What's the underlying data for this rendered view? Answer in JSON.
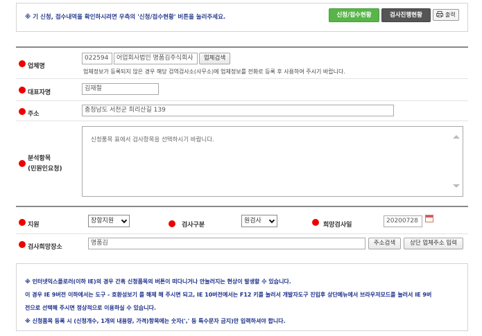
{
  "top_notice": {
    "text": "※ 기 신청, 접수내역을 확인하시려면 우측의 '신청/접수현황' 버튼을 눌러주세요.",
    "status_button": "신청/접수현황",
    "progress_button": "검사진행현황",
    "print_button": "출력"
  },
  "form": {
    "company": {
      "label": "업체명",
      "code": "022594",
      "name": "어업회사법인 명품김주식회사",
      "search_button": "업체검색",
      "help": "업체정보가 등록되지 않은 경우 해당 검역검사소(사무소)에 업체정보를 전화로 등록 후 사용하여 주시기 바랍니다."
    },
    "representative": {
      "label": "대표자명",
      "value": "김재철"
    },
    "address": {
      "label": "주소",
      "value": "충청남도 서천군 희리산길 139"
    },
    "analysis": {
      "label_line1": "분석항목",
      "label_line2": "(민원인요청)",
      "placeholder": "신청품목 표에서 검사항목을 선택하시기 바랍니다."
    },
    "branch": {
      "label": "지원",
      "value": "장항지원"
    },
    "inspection_type": {
      "label": "검사구분",
      "value": "원검사"
    },
    "desired_date": {
      "label": "희망검사일",
      "value": "20200728"
    },
    "location": {
      "label": "검사희망장소",
      "value": "명품김",
      "address_search_button": "주소검색",
      "company_address_button": "상단 업체주소 입력"
    }
  },
  "bottom_notes": {
    "line1": "※ 인터넷익스플로러(이하 IE)의 경우 간혹 신청품목의 버튼이 떠다니거나 안눌러지는 현상이 발생할 수 있습니다.",
    "line2": "이 경우 IE 9버전 이하에서는 도구 - 호환성보기 를 해제 해 주시면 되고, IE 10버전에서는 F12 키를 눌러서 개발자도구 진입후 상단메뉴에서 브라우저모드를 눌러서 IE 9버",
    "line3": "전으로 선택해 주시면 정상적으로 이용하실 수 있습니다.",
    "line4": "※ 신청품목 등록 시 (신청개수, 1개의 내용량, 가격)항목에는 숫자(',' 등 특수문자 금지)만 입력하셔야 합니다."
  },
  "colors": {
    "required_dot": "#ee0000",
    "green_button": "#58b548",
    "dark_button": "#555555",
    "notice_text": "#2a3d8f"
  }
}
